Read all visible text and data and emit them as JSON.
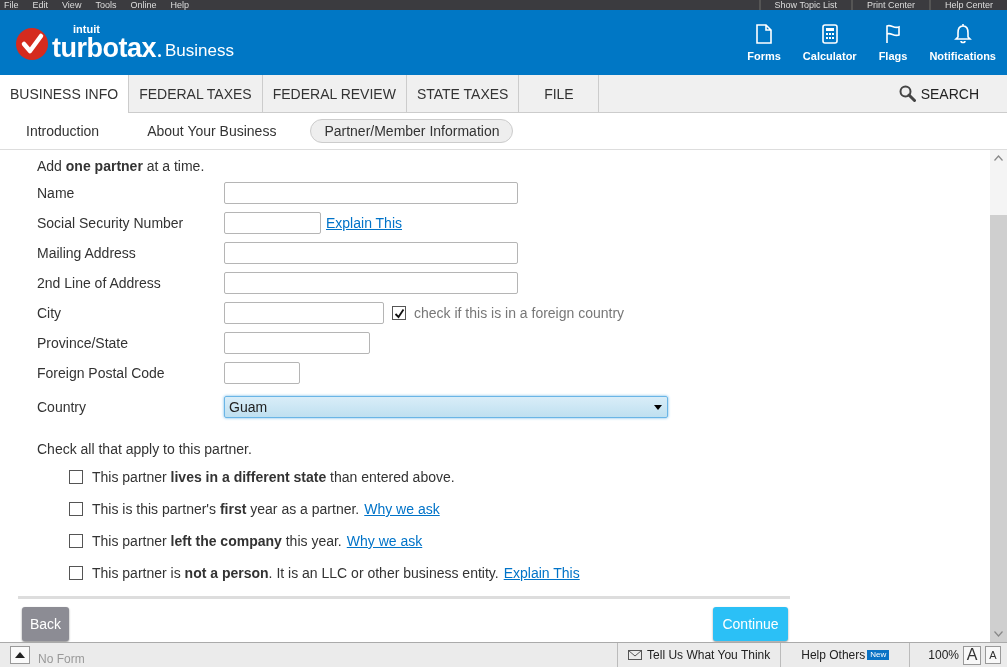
{
  "menu_bar": {
    "items": [
      "File",
      "Edit",
      "View",
      "Tools",
      "Online",
      "Help"
    ],
    "actions": [
      "Show Topic List",
      "Print Center",
      "Help Center"
    ]
  },
  "header": {
    "logo": {
      "company": "intuit",
      "product": "turbotax",
      "edition": "Business"
    },
    "tools": [
      {
        "label": "Forms",
        "kind": "document"
      },
      {
        "label": "Calculator",
        "kind": "calculator"
      },
      {
        "label": "Flags",
        "kind": "flag"
      },
      {
        "label": "Notifications",
        "kind": "bell"
      }
    ]
  },
  "tabs": [
    {
      "label": "BUSINESS INFO",
      "selected": true
    },
    {
      "label": "FEDERAL TAXES",
      "selected": false
    },
    {
      "label": "FEDERAL REVIEW",
      "selected": false
    },
    {
      "label": "STATE TAXES",
      "selected": false
    },
    {
      "label": "FILE",
      "selected": false
    }
  ],
  "search": {
    "label": "SEARCH"
  },
  "subnav": [
    {
      "label": "Introduction",
      "selected": false
    },
    {
      "label": "About Your Business",
      "selected": false
    },
    {
      "label": "Partner/Member Information",
      "selected": true
    }
  ],
  "form": {
    "intro": "Add **one partner** at a time.",
    "fields": [
      {
        "label": "Name",
        "kind": "text"
      },
      {
        "label": "Social Security Number",
        "kind": "text",
        "link": "Explain This"
      },
      {
        "label": "Mailing Address",
        "kind": "text"
      },
      {
        "label": "2nd Line of Address",
        "kind": "text"
      },
      {
        "label": "City",
        "kind": "text",
        "checkbox": {
          "label": "check if this is in a foreign country",
          "checked": true
        }
      },
      {
        "label": "Province/State",
        "kind": "text"
      },
      {
        "label": "Foreign Postal Code",
        "kind": "text"
      },
      {
        "label": "Country",
        "kind": "select",
        "value": "Guam"
      }
    ],
    "check_heading": "Check all that apply to this partner.",
    "checks": [
      {
        "text": "This partner **lives in a different state** than entered above.",
        "checked": false
      },
      {
        "text": "This is this partner's **first** year as a partner.",
        "checked": false,
        "link": "Why we ask"
      },
      {
        "text": "This partner **left the company** this year.",
        "checked": false,
        "link": "Why we ask"
      },
      {
        "text": "This partner is **not a person**. It is an LLC or other business entity.",
        "checked": false,
        "link": "Explain This"
      }
    ]
  },
  "buttons": {
    "back": "Back",
    "continue": "Continue"
  },
  "status_bar": {
    "form": "No Form",
    "feedback": "Tell Us What You Think",
    "help_others": "Help Others",
    "badge": "New",
    "zoom": "100%",
    "font_large": "A",
    "font_small": "A"
  }
}
